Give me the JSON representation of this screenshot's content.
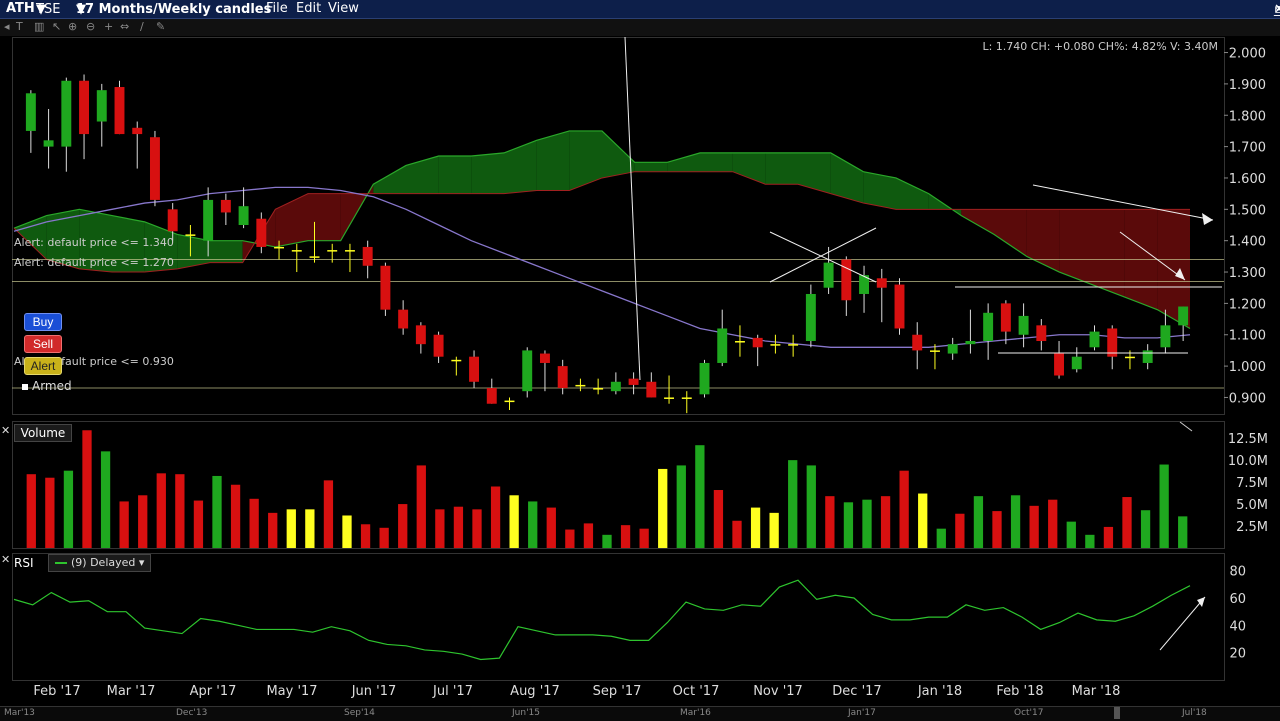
{
  "titlebar": {
    "symbol": "ATH",
    "exchange": "TSE",
    "period": "17 Months/Weekly candles",
    "menu": [
      "File",
      "Edit",
      "View"
    ]
  },
  "price_pane": {
    "readout": "L: 1.740 CH: +0.080 CH%: 4.82% V: 3.40M",
    "y_ticks": [
      "2.000",
      "1.900",
      "1.800",
      "1.700",
      "1.600",
      "1.500",
      "1.400",
      "1.300",
      "1.200",
      "1.100",
      "1.000",
      "0.900"
    ],
    "alerts": [
      {
        "text": "Alert: default price <= 1.340",
        "price": 1.34
      },
      {
        "text": "Alert: default price <= 1.270",
        "price": 1.27
      },
      {
        "text": "Alert: default price <= 0.930",
        "price": 0.93
      }
    ],
    "buttons": {
      "buy": "Buy",
      "sell": "Sell",
      "alert": "Alert"
    },
    "armed": "Armed"
  },
  "volume_pane": {
    "label": "Volume",
    "y_ticks": [
      "12.5M",
      "10.0M",
      "7.5M",
      "5.0M",
      "2.5M"
    ]
  },
  "rsi_pane": {
    "label": "RSI",
    "legend": "(9) Delayed",
    "y_ticks": [
      "80",
      "60",
      "40",
      "20"
    ]
  },
  "x_axis": {
    "months": [
      "Feb '17",
      "Mar '17",
      "Apr '17",
      "May '17",
      "Jun '17",
      "Jul '17",
      "Aug '17",
      "Sep '17",
      "Oct '17",
      "Nov '17",
      "Dec '17",
      "Jan '18",
      "Feb '18",
      "Mar '18"
    ]
  },
  "scrollbar": {
    "labels": [
      "Mar'13",
      "Dec'13",
      "Sep'14",
      "Jun'15",
      "Mar'16",
      "Jan'17",
      "Oct'17",
      "Jul'18"
    ]
  },
  "colors": {
    "up": "#1fa81f",
    "down": "#d81010",
    "neutral": "#ffff20",
    "cloud_green": "#0f5a0f",
    "cloud_red": "#5a0a0a",
    "rsi": "#2ec42e",
    "ma": "#8877cc"
  },
  "chart_data": {
    "type": "candlestick",
    "price_range": [
      0.86,
      2.04
    ],
    "candles": [
      {
        "o": 1.75,
        "h": 1.88,
        "l": 1.68,
        "c": 1.87
      },
      {
        "o": 1.7,
        "h": 1.82,
        "l": 1.63,
        "c": 1.72
      },
      {
        "o": 1.7,
        "h": 1.92,
        "l": 1.62,
        "c": 1.91
      },
      {
        "o": 1.91,
        "h": 1.93,
        "l": 1.66,
        "c": 1.74
      },
      {
        "o": 1.78,
        "h": 1.9,
        "l": 1.7,
        "c": 1.88
      },
      {
        "o": 1.89,
        "h": 1.91,
        "l": 1.74,
        "c": 1.74
      },
      {
        "o": 1.76,
        "h": 1.78,
        "l": 1.63,
        "c": 1.74
      },
      {
        "o": 1.73,
        "h": 1.75,
        "l": 1.51,
        "c": 1.53
      },
      {
        "o": 1.5,
        "h": 1.52,
        "l": 1.4,
        "c": 1.43
      },
      {
        "o": 1.42,
        "h": 1.45,
        "l": 1.35,
        "c": 1.42
      },
      {
        "o": 1.4,
        "h": 1.57,
        "l": 1.35,
        "c": 1.53
      },
      {
        "o": 1.53,
        "h": 1.55,
        "l": 1.45,
        "c": 1.49
      },
      {
        "o": 1.45,
        "h": 1.57,
        "l": 1.44,
        "c": 1.51
      },
      {
        "o": 1.47,
        "h": 1.49,
        "l": 1.36,
        "c": 1.38
      },
      {
        "o": 1.38,
        "h": 1.4,
        "l": 1.34,
        "c": 1.38
      },
      {
        "o": 1.37,
        "h": 1.39,
        "l": 1.3,
        "c": 1.37
      },
      {
        "o": 1.35,
        "h": 1.46,
        "l": 1.33,
        "c": 1.35
      },
      {
        "o": 1.37,
        "h": 1.39,
        "l": 1.33,
        "c": 1.37
      },
      {
        "o": 1.37,
        "h": 1.39,
        "l": 1.3,
        "c": 1.37
      },
      {
        "o": 1.38,
        "h": 1.4,
        "l": 1.28,
        "c": 1.32
      },
      {
        "o": 1.32,
        "h": 1.33,
        "l": 1.16,
        "c": 1.18
      },
      {
        "o": 1.18,
        "h": 1.21,
        "l": 1.1,
        "c": 1.12
      },
      {
        "o": 1.13,
        "h": 1.14,
        "l": 1.04,
        "c": 1.07
      },
      {
        "o": 1.1,
        "h": 1.11,
        "l": 1.01,
        "c": 1.03
      },
      {
        "o": 1.02,
        "h": 1.03,
        "l": 0.97,
        "c": 1.02
      },
      {
        "o": 1.03,
        "h": 1.05,
        "l": 0.93,
        "c": 0.95
      },
      {
        "o": 0.93,
        "h": 0.96,
        "l": 0.88,
        "c": 0.88
      },
      {
        "o": 0.89,
        "h": 0.9,
        "l": 0.86,
        "c": 0.89
      },
      {
        "o": 0.92,
        "h": 1.06,
        "l": 0.9,
        "c": 1.05
      },
      {
        "o": 1.04,
        "h": 1.05,
        "l": 0.92,
        "c": 1.01
      },
      {
        "o": 1.0,
        "h": 1.02,
        "l": 0.91,
        "c": 0.93
      },
      {
        "o": 0.94,
        "h": 0.96,
        "l": 0.92,
        "c": 0.94
      },
      {
        "o": 0.93,
        "h": 0.96,
        "l": 0.91,
        "c": 0.93
      },
      {
        "o": 0.92,
        "h": 0.98,
        "l": 0.91,
        "c": 0.95
      },
      {
        "o": 0.96,
        "h": 0.98,
        "l": 0.91,
        "c": 0.94
      },
      {
        "o": 0.95,
        "h": 0.98,
        "l": 0.9,
        "c": 0.9
      },
      {
        "o": 0.9,
        "h": 0.97,
        "l": 0.88,
        "c": 0.9
      },
      {
        "o": 0.9,
        "h": 0.92,
        "l": 0.85,
        "c": 0.9
      },
      {
        "o": 0.91,
        "h": 1.02,
        "l": 0.9,
        "c": 1.01
      },
      {
        "o": 1.01,
        "h": 1.18,
        "l": 1.0,
        "c": 1.12
      },
      {
        "o": 1.08,
        "h": 1.13,
        "l": 1.03,
        "c": 1.08
      },
      {
        "o": 1.09,
        "h": 1.1,
        "l": 1.0,
        "c": 1.06
      },
      {
        "o": 1.07,
        "h": 1.1,
        "l": 1.04,
        "c": 1.07
      },
      {
        "o": 1.07,
        "h": 1.1,
        "l": 1.03,
        "c": 1.07
      },
      {
        "o": 1.08,
        "h": 1.26,
        "l": 1.06,
        "c": 1.23
      },
      {
        "o": 1.25,
        "h": 1.38,
        "l": 1.23,
        "c": 1.33
      },
      {
        "o": 1.34,
        "h": 1.35,
        "l": 1.16,
        "c": 1.21
      },
      {
        "o": 1.23,
        "h": 1.32,
        "l": 1.17,
        "c": 1.29
      },
      {
        "o": 1.28,
        "h": 1.31,
        "l": 1.14,
        "c": 1.25
      },
      {
        "o": 1.26,
        "h": 1.28,
        "l": 1.1,
        "c": 1.12
      },
      {
        "o": 1.1,
        "h": 1.14,
        "l": 0.99,
        "c": 1.05
      },
      {
        "o": 1.05,
        "h": 1.07,
        "l": 0.99,
        "c": 1.05
      },
      {
        "o": 1.04,
        "h": 1.09,
        "l": 1.02,
        "c": 1.07
      },
      {
        "o": 1.07,
        "h": 1.18,
        "l": 1.04,
        "c": 1.08
      },
      {
        "o": 1.08,
        "h": 1.2,
        "l": 1.02,
        "c": 1.17
      },
      {
        "o": 1.2,
        "h": 1.21,
        "l": 1.07,
        "c": 1.11
      },
      {
        "o": 1.1,
        "h": 1.2,
        "l": 1.06,
        "c": 1.16
      },
      {
        "o": 1.13,
        "h": 1.15,
        "l": 1.05,
        "c": 1.08
      },
      {
        "o": 1.04,
        "h": 1.08,
        "l": 0.96,
        "c": 0.97
      },
      {
        "o": 0.99,
        "h": 1.06,
        "l": 0.98,
        "c": 1.03
      },
      {
        "o": 1.06,
        "h": 1.13,
        "l": 1.05,
        "c": 1.11
      },
      {
        "o": 1.12,
        "h": 1.13,
        "l": 0.99,
        "c": 1.03
      },
      {
        "o": 1.03,
        "h": 1.05,
        "l": 0.99,
        "c": 1.03
      },
      {
        "o": 1.01,
        "h": 1.07,
        "l": 0.99,
        "c": 1.05
      },
      {
        "o": 1.06,
        "h": 1.18,
        "l": 1.04,
        "c": 1.13
      },
      {
        "o": 1.13,
        "h": 1.19,
        "l": 1.08,
        "c": 1.19
      }
    ],
    "volume": [
      {
        "v": 8.4,
        "d": "down"
      },
      {
        "v": 8.0,
        "d": "down"
      },
      {
        "v": 8.8,
        "d": "up"
      },
      {
        "v": 13.4,
        "d": "down"
      },
      {
        "v": 11.0,
        "d": "up"
      },
      {
        "v": 5.3,
        "d": "down"
      },
      {
        "v": 6.0,
        "d": "down"
      },
      {
        "v": 8.5,
        "d": "down"
      },
      {
        "v": 8.4,
        "d": "down"
      },
      {
        "v": 5.4,
        "d": "down"
      },
      {
        "v": 8.2,
        "d": "up"
      },
      {
        "v": 7.2,
        "d": "down"
      },
      {
        "v": 5.6,
        "d": "down"
      },
      {
        "v": 4.0,
        "d": "down"
      },
      {
        "v": 4.4,
        "d": "flat"
      },
      {
        "v": 4.4,
        "d": "flat"
      },
      {
        "v": 7.7,
        "d": "down"
      },
      {
        "v": 3.7,
        "d": "flat"
      },
      {
        "v": 2.7,
        "d": "down"
      },
      {
        "v": 2.3,
        "d": "down"
      },
      {
        "v": 5.0,
        "d": "down"
      },
      {
        "v": 9.4,
        "d": "down"
      },
      {
        "v": 4.4,
        "d": "down"
      },
      {
        "v": 4.7,
        "d": "down"
      },
      {
        "v": 4.4,
        "d": "down"
      },
      {
        "v": 7.0,
        "d": "down"
      },
      {
        "v": 6.0,
        "d": "flat"
      },
      {
        "v": 5.3,
        "d": "up"
      },
      {
        "v": 4.6,
        "d": "down"
      },
      {
        "v": 2.1,
        "d": "down"
      },
      {
        "v": 2.8,
        "d": "down"
      },
      {
        "v": 1.5,
        "d": "up"
      },
      {
        "v": 2.6,
        "d": "down"
      },
      {
        "v": 2.2,
        "d": "down"
      },
      {
        "v": 9.0,
        "d": "flat"
      },
      {
        "v": 9.4,
        "d": "up"
      },
      {
        "v": 11.7,
        "d": "up"
      },
      {
        "v": 6.6,
        "d": "down"
      },
      {
        "v": 3.1,
        "d": "down"
      },
      {
        "v": 4.6,
        "d": "flat"
      },
      {
        "v": 4.0,
        "d": "flat"
      },
      {
        "v": 10.0,
        "d": "up"
      },
      {
        "v": 9.4,
        "d": "up"
      },
      {
        "v": 5.9,
        "d": "down"
      },
      {
        "v": 5.2,
        "d": "up"
      },
      {
        "v": 5.5,
        "d": "up"
      },
      {
        "v": 5.9,
        "d": "down"
      },
      {
        "v": 8.8,
        "d": "down"
      },
      {
        "v": 6.2,
        "d": "flat"
      },
      {
        "v": 2.2,
        "d": "up"
      },
      {
        "v": 3.9,
        "d": "down"
      },
      {
        "v": 5.9,
        "d": "up"
      },
      {
        "v": 4.2,
        "d": "down"
      },
      {
        "v": 6.0,
        "d": "up"
      },
      {
        "v": 4.8,
        "d": "down"
      },
      {
        "v": 5.5,
        "d": "down"
      },
      {
        "v": 3.0,
        "d": "up"
      },
      {
        "v": 1.5,
        "d": "up"
      },
      {
        "v": 2.4,
        "d": "down"
      },
      {
        "v": 5.8,
        "d": "down"
      },
      {
        "v": 4.3,
        "d": "up"
      },
      {
        "v": 9.5,
        "d": "up"
      },
      {
        "v": 3.6,
        "d": "up"
      }
    ],
    "volume_range": [
      0,
      14
    ],
    "rsi": [
      59,
      55,
      64,
      57,
      58,
      50,
      50,
      38,
      36,
      34,
      45,
      43,
      40,
      37,
      37,
      37,
      35,
      39,
      36,
      29,
      26,
      25,
      22,
      21,
      19,
      15,
      16,
      39,
      36,
      33,
      33,
      33,
      32,
      29,
      29,
      42,
      57,
      52,
      51,
      55,
      54,
      68,
      73,
      59,
      62,
      60,
      48,
      44,
      44,
      46,
      46,
      55,
      51,
      53,
      46,
      37,
      42,
      49,
      44,
      43,
      47,
      54,
      62,
      69
    ],
    "rsi_range": [
      0,
      90
    ],
    "ma_curve": [
      1.43,
      1.46,
      1.48,
      1.5,
      1.52,
      1.53,
      1.55,
      1.56,
      1.57,
      1.57,
      1.56,
      1.54,
      1.5,
      1.45,
      1.4,
      1.36,
      1.32,
      1.28,
      1.24,
      1.2,
      1.16,
      1.12,
      1.1,
      1.08,
      1.07,
      1.06,
      1.06,
      1.06,
      1.06,
      1.07,
      1.08,
      1.09,
      1.1,
      1.1,
      1.09,
      1.09,
      1.1
    ],
    "tenkan_top": [
      1.44,
      1.48,
      1.5,
      1.48,
      1.46,
      1.42,
      1.4,
      1.4,
      1.38,
      1.4,
      1.4,
      1.58,
      1.64,
      1.67,
      1.67,
      1.68,
      1.72,
      1.75,
      1.75,
      1.65,
      1.65,
      1.68,
      1.68,
      1.68,
      1.68,
      1.68,
      1.62,
      1.6,
      1.55,
      1.48,
      1.42,
      1.35,
      1.3,
      1.26,
      1.22,
      1.18,
      1.12
    ],
    "cloud_bottom": [
      1.44,
      1.34,
      1.31,
      1.3,
      1.3,
      1.31,
      1.33,
      1.33,
      1.5,
      1.55,
      1.55,
      1.55,
      1.55,
      1.55,
      1.55,
      1.55,
      1.56,
      1.56,
      1.6,
      1.62,
      1.62,
      1.62,
      1.62,
      1.58,
      1.58,
      1.55,
      1.52,
      1.5,
      1.5,
      1.5,
      1.5,
      1.5,
      1.5,
      1.5,
      1.5,
      1.5,
      1.5
    ],
    "x_labels": [
      "Feb '17",
      "Mar '17",
      "Apr '17",
      "May '17",
      "Jun '17",
      "Jul '17",
      "Aug '17",
      "Sep '17",
      "Oct '17",
      "Nov '17",
      "Dec '17",
      "Jan '18",
      "Feb '18",
      "Mar '18"
    ]
  }
}
